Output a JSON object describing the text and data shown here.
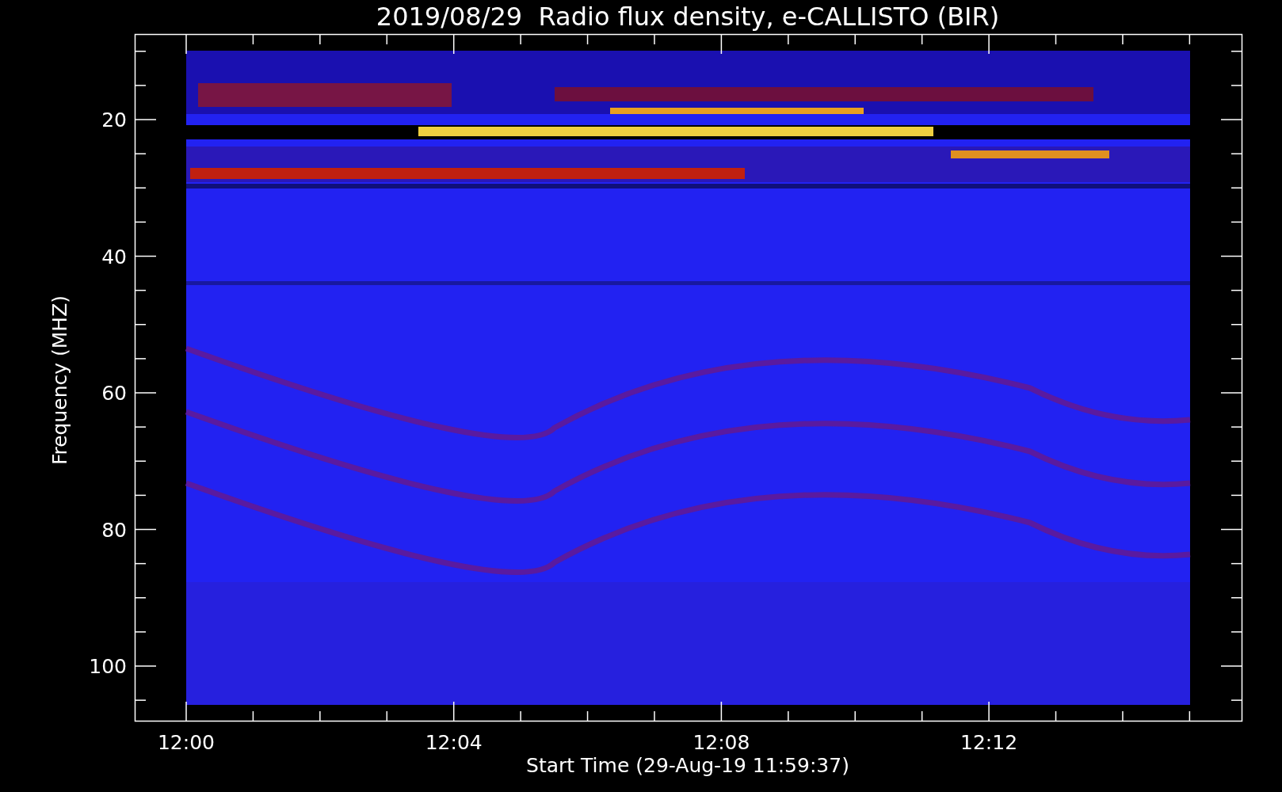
{
  "title": "2019/08/29  Radio flux density, e-CALLISTO (BIR)",
  "xlabel": "Start Time (29-Aug-19 11:59:37)",
  "ylabel": "Frequency (MHZ)",
  "xtick_labels": [
    "12:00",
    "12:04",
    "12:08",
    "12:12"
  ],
  "ytick_labels": [
    "20",
    "40",
    "60",
    "80",
    "100"
  ]
}
